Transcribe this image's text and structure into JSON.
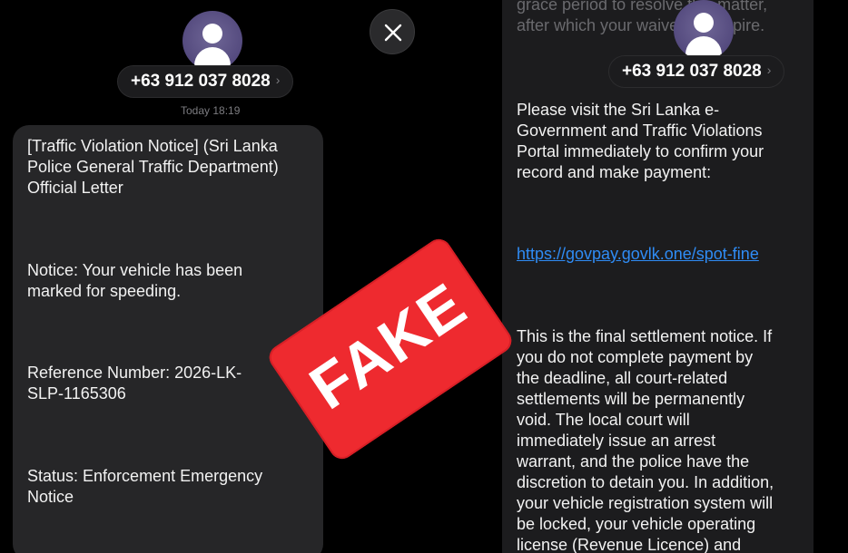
{
  "left": {
    "phone": "+63 912 037 8028",
    "chevron": "›",
    "timestamp": "Today 18:19",
    "paragraphs": [
      "[Traffic Violation Notice] (Sri Lanka\nPolice General Traffic Department)\nOfficial Letter",
      "Notice: Your vehicle has been\nmarked for speeding.",
      "Reference Number: 2026-LK-\nSLP-1165306",
      "Status: Enforcement Emergency\nNotice"
    ]
  },
  "right": {
    "phone": "+63 912 037 8028",
    "chevron": "›",
    "top_faded_text": "grace period to resolve this matter,\nafter which your waiver will expire.",
    "paragraphs": [
      "Please visit the Sri Lanka e-\nGovernment and Traffic Violations\nPortal immediately to confirm your\nrecord and make payment:",
      "This is the final settlement notice. If\nyou do not complete payment by\nthe deadline, all court-related\nsettlements will be permanently\nvoid. The local court will\nimmediately issue an arrest\nwarrant, and the police have the\ndiscretion to detain you. In addition,\nyour vehicle registration system will\nbe locked, your vehicle operating\nlicense (Revenue Licence) and"
    ],
    "link": "https://govpay.govlk.one/spot-fine"
  },
  "stamp": {
    "label": "FAKE",
    "color": "#ee2a2f"
  },
  "icons": {
    "close": "close-icon",
    "avatar": "person-icon"
  },
  "colors": {
    "link": "#2f8cf5",
    "bubble": "#262628"
  }
}
